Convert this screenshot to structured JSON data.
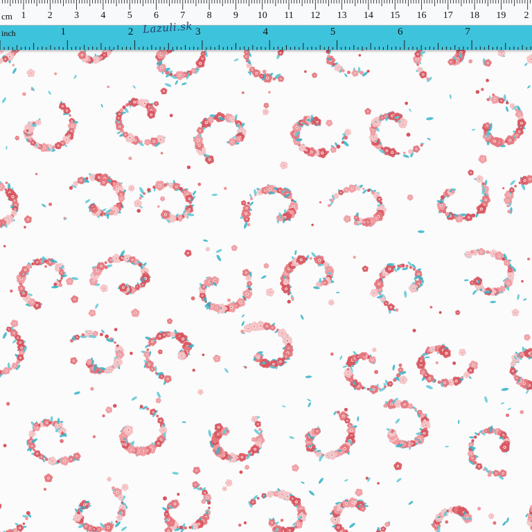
{
  "ruler": {
    "cm_unit": "cm",
    "inch_unit": "inch",
    "brand": "Lazuli.sk",
    "cm_numbers": [
      "1",
      "2",
      "3",
      "4",
      "5",
      "6",
      "7",
      "8",
      "9",
      "10",
      "11",
      "12",
      "13",
      "14",
      "15",
      "16",
      "17",
      "18",
      "19",
      "2"
    ],
    "inch_numbers": [
      "1",
      "2",
      "3",
      "4",
      "5",
      "6",
      "7"
    ]
  },
  "fabric": {
    "background_color": "#fbfbfb",
    "flower_colors": [
      "#e4747c",
      "#f09aa0",
      "#d9545e",
      "#f5c2c4"
    ],
    "leaf_color": "#5cc7d6",
    "leaf_dark": "#33b2c7",
    "pattern": "ditsy-floral-paisley"
  },
  "colors": {
    "ruler_blue": "#3ec3dc",
    "ruler_white": "#f7f9fa"
  }
}
